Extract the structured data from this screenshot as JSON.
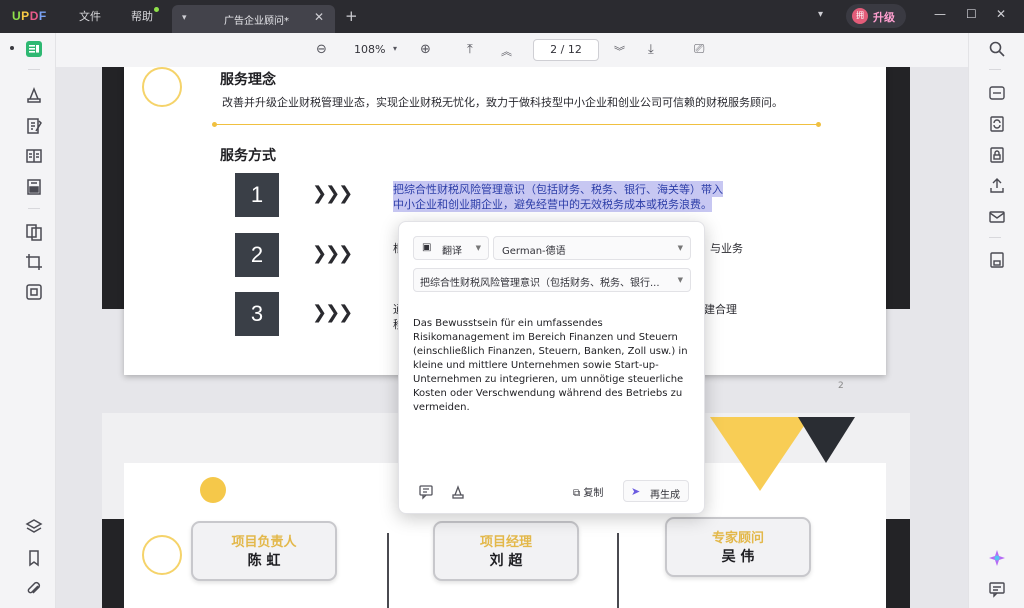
{
  "titlebar": {
    "logo": [
      "U",
      "P",
      "D",
      "F"
    ],
    "menu_file": "文件",
    "menu_help": "帮助",
    "tab_title": "广告企业顾问*",
    "tab_close": "✕",
    "add_tab": "+",
    "upgrade_avatar": "拥",
    "upgrade_label": "升级"
  },
  "toolbar": {
    "zoom": "108%",
    "page_current": "2",
    "page_sep": "/",
    "page_total": "12"
  },
  "page1": {
    "heading1": "服务理念",
    "para1": "改善并升级企业财税管理业态，实现企业财税无忧化，致力于做科技型中小企业和创业公司可信赖的财税服务顾问。",
    "heading2": "服务方式",
    "steps": [
      "1",
      "2",
      "3"
    ],
    "chevrons": "❯❯❯",
    "highlight_line1": "把综合性财税风险管理意识（包括财务、税务、银行、海关等）带入",
    "highlight_line2": "中小企业和创业期企业，避免经营中的无效税务成本或税务浪费。",
    "row2_left": "根",
    "row2_right": "与业务",
    "row3_left": "通",
    "row3_left2": "移",
    "row3_right": "建合理",
    "page_number": "2"
  },
  "page2": {
    "cards": [
      {
        "role": "项目负责人",
        "person": "陈 虹"
      },
      {
        "role": "项目经理",
        "person": "刘 超"
      },
      {
        "role": "专家顾问",
        "person": "吴 伟"
      }
    ]
  },
  "popup": {
    "mode_label": "翻译",
    "language": "German-德语",
    "source": "把综合性财税风险管理意识（包括财务、税务、银行...",
    "translation": "Das Bewusstsein für ein umfassendes Risikomanagement im Bereich Finanzen und Steuern (einschließlich Finanzen, Steuern, Banken, Zoll usw.) in kleine und mittlere Unternehmen sowie Start-up-Unternehmen zu integrieren, um unnötige steuerliche Kosten oder Verschwendung während des Betriebs zu vermeiden.",
    "copy_label": "复制",
    "regen_label": "再生成"
  },
  "colors": {
    "accent_yellow": "#f5d36a",
    "highlight": "#c7c7f2",
    "regen_purple": "#6b5be0"
  }
}
